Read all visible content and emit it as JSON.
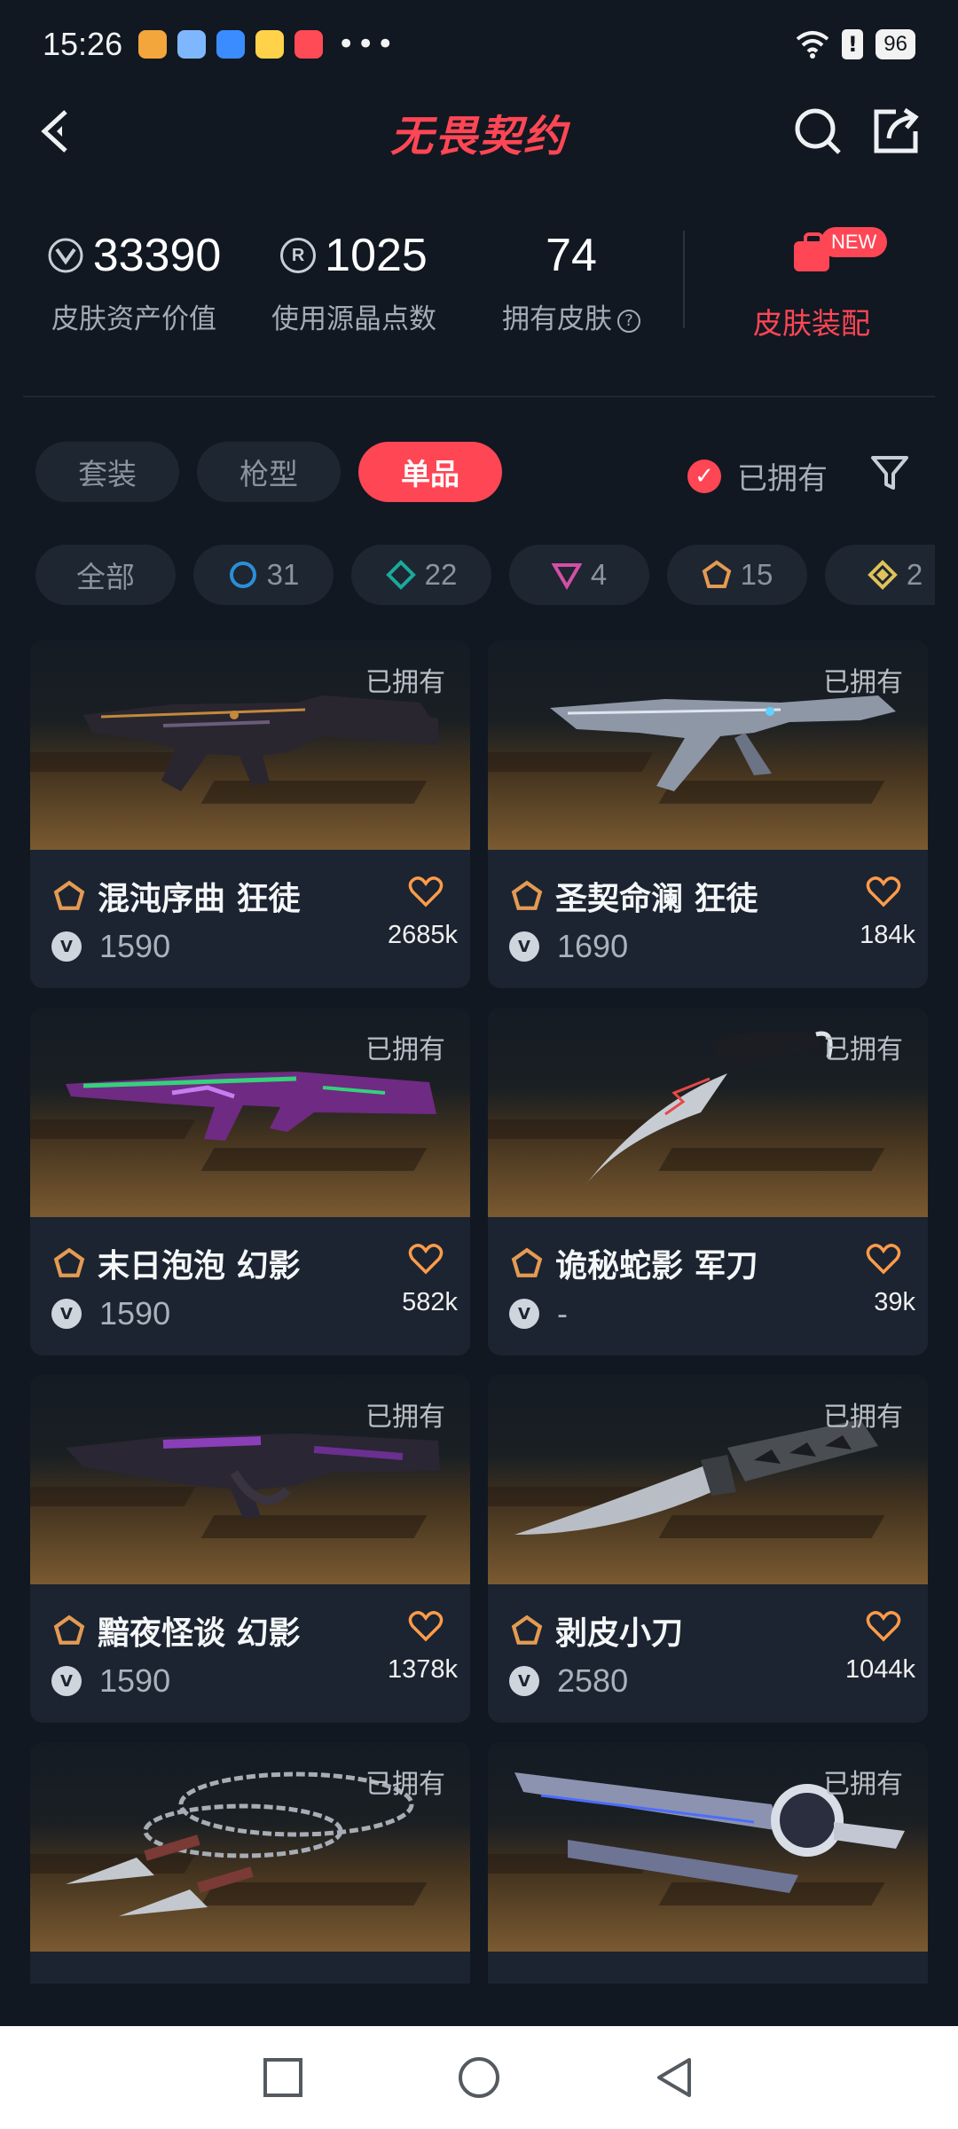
{
  "status_bar": {
    "time": "15:26",
    "more": "•••",
    "battery": "96",
    "notification_colors": [
      "#f2a63b",
      "#7fb7ff",
      "#3b8cff",
      "#ffd24a",
      "#ff4b55"
    ]
  },
  "header": {
    "title": "无畏契约",
    "icons": [
      "back-icon",
      "search-icon",
      "share-icon"
    ]
  },
  "stats": [
    {
      "value": "33390",
      "label": "皮肤资产价值",
      "icon": "vp-icon"
    },
    {
      "value": "1025",
      "label": "使用源晶点数",
      "icon": "radianite-icon"
    },
    {
      "value": "74",
      "label": "拥有皮肤",
      "icon": "help-icon"
    }
  ],
  "equip": {
    "label": "皮肤装配",
    "badge": "NEW"
  },
  "category_tabs": [
    {
      "label": "套装",
      "active": false
    },
    {
      "label": "枪型",
      "active": false
    },
    {
      "label": "单品",
      "active": true
    }
  ],
  "owned_filter": {
    "label": "已拥有",
    "checked": true
  },
  "rarity_chips": [
    {
      "label": "全部"
    },
    {
      "count": "31",
      "color": "#2b8fd8",
      "icon": "select-tier-icon"
    },
    {
      "count": "22",
      "color": "#1aa99c",
      "icon": "deluxe-tier-icon"
    },
    {
      "count": "4",
      "color": "#d24fa5",
      "icon": "premium-tier-icon"
    },
    {
      "count": "15",
      "color": "#e49a53",
      "icon": "exclusive-tier-icon"
    },
    {
      "count": "2",
      "color": "#e0c25a",
      "icon": "ultra-tier-icon"
    }
  ],
  "cards": [
    {
      "name": "混沌序曲 狂徒",
      "price": "1590",
      "likes": "2685k",
      "owned": "已拥有"
    },
    {
      "name": "圣契命澜 狂徒",
      "price": "1690",
      "likes": "184k",
      "owned": "已拥有"
    },
    {
      "name": "末日泡泡 幻影",
      "price": "1590",
      "likes": "582k",
      "owned": "已拥有"
    },
    {
      "name": "诡秘蛇影 军刀",
      "price": "-",
      "likes": "39k",
      "owned": "已拥有"
    },
    {
      "name": "黯夜怪谈 幻影",
      "price": "1590",
      "likes": "1378k",
      "owned": "已拥有"
    },
    {
      "name": "剥皮小刀",
      "price": "2580",
      "likes": "1044k",
      "owned": "已拥有"
    },
    {
      "name": "",
      "price": "",
      "likes": "",
      "owned": "已拥有"
    },
    {
      "name": "",
      "price": "",
      "likes": "",
      "owned": "已拥有"
    }
  ],
  "accent_color": "#ff4655",
  "nav_bar": {
    "icons": [
      "recent-apps-icon",
      "home-icon",
      "back-nav-icon"
    ]
  }
}
